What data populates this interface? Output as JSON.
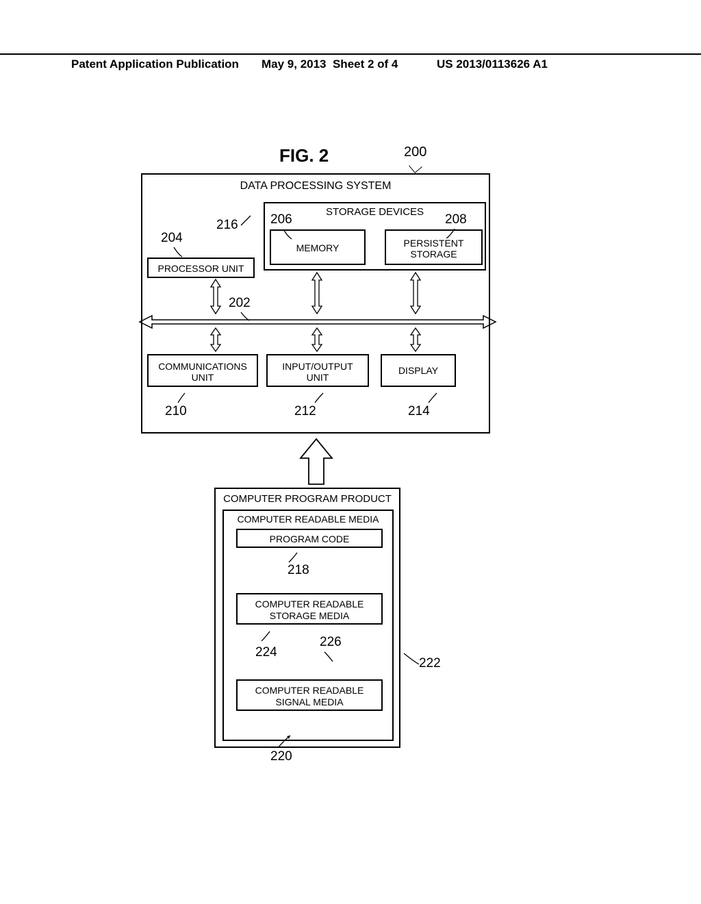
{
  "header": {
    "left": "Patent Application Publication",
    "date": "May 9, 2013",
    "sheet": "Sheet 2 of 4",
    "pubno": "US 2013/0113626 A1"
  },
  "figure": {
    "title": "FIG. 2",
    "ref_system": "200",
    "system_title": "DATA PROCESSING SYSTEM",
    "storage_title": "STORAGE DEVICES",
    "memory": "MEMORY",
    "persistent": "PERSISTENT STORAGE",
    "persistent_l1": "PERSISTENT",
    "persistent_l2": "STORAGE",
    "processor": "PROCESSOR UNIT",
    "comm": "COMMUNICATIONS UNIT",
    "comm_l1": "COMMUNICATIONS",
    "comm_l2": "UNIT",
    "io": "INPUT/OUTPUT UNIT",
    "io_l1": "INPUT/OUTPUT",
    "io_l2": "UNIT",
    "display": "DISPLAY",
    "refs": {
      "bus": "202",
      "processor": "204",
      "memory": "206",
      "persistent": "208",
      "comm": "210",
      "io": "212",
      "display": "214",
      "storage": "216"
    },
    "product": {
      "title": "COMPUTER PROGRAM PRODUCT",
      "media_title": "COMPUTER READABLE MEDIA",
      "program_code": "PROGRAM CODE",
      "storage_media": "COMPUTER READABLE STORAGE MEDIA",
      "storage_media_l1": "COMPUTER READABLE",
      "storage_media_l2": "STORAGE MEDIA",
      "signal_media": "COMPUTER READABLE SIGNAL MEDIA",
      "signal_media_l1": "COMPUTER READABLE",
      "signal_media_l2": "SIGNAL MEDIA",
      "refs": {
        "program_code": "218",
        "media": "220",
        "product": "222",
        "storage_media": "224",
        "signal_media_leader": "226"
      }
    }
  }
}
